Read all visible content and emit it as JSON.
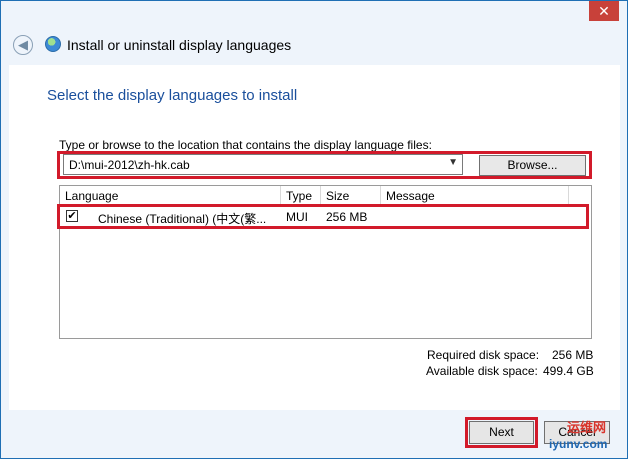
{
  "window": {
    "title": "Install or uninstall display languages",
    "close_glyph": "✕",
    "back_glyph": "◀"
  },
  "main": {
    "heading": "Select the display languages to install",
    "path_label": "Type or browse to the location that contains the display language files:",
    "path_value": "D:\\mui-2012\\zh-hk.cab",
    "browse_label": "Browse..."
  },
  "list": {
    "columns": [
      "Language",
      "Type",
      "Size",
      "Message"
    ],
    "rows": [
      {
        "checked": "✔",
        "language": "Chinese (Traditional) (中文(繁...",
        "type": "MUI",
        "size": "256 MB",
        "message": ""
      }
    ]
  },
  "disk": {
    "required_label": "Required disk space:",
    "required_value": "256 MB",
    "available_label": "Available disk space:",
    "available_value": "499.4 GB"
  },
  "buttons": {
    "next": "Next",
    "cancel": "Cancel"
  },
  "watermark": {
    "line1": "运维网",
    "line2": "iyunv.com"
  },
  "colors": {
    "highlight": "#d21a2a",
    "heading": "#1a4f9c",
    "titlebar_close": "#c8413a"
  }
}
